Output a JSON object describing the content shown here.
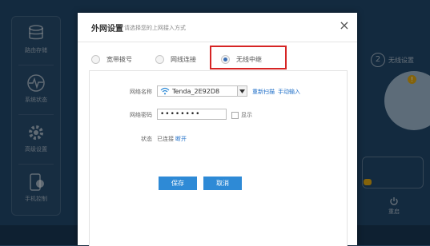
{
  "dialog": {
    "title": "外网设置",
    "subtitle": "请选择您的上网接入方式",
    "close_glyph": "×"
  },
  "modes": [
    {
      "label": "宽带拨号",
      "checked": false
    },
    {
      "label": "网线连接",
      "checked": false
    },
    {
      "label": "无线中继",
      "checked": true
    }
  ],
  "form": {
    "ssid_label": "网络名称",
    "ssid_value": "Tenda_2E92D8",
    "rescan": "重新扫描",
    "manual": "手动输入",
    "password_label": "网络密码",
    "password_value": "••••••••",
    "show_label": "显示",
    "status_label": "状态",
    "status_value": "已连接",
    "status_link": "断开"
  },
  "buttons": {
    "save": "保存",
    "cancel": "取消"
  },
  "background": {
    "sidebar": [
      {
        "label": "路由存储",
        "icon": "database-icon"
      },
      {
        "label": "系统状态",
        "icon": "pulse-icon"
      },
      {
        "label": "高级设置",
        "icon": "gear-icon"
      },
      {
        "label": "手机控制",
        "icon": "phone-icon"
      }
    ],
    "step_number": "2",
    "step_label": "无线设置",
    "badge": "!",
    "reboot_label": "重启"
  },
  "colors": {
    "accent": "#2e8ad6",
    "highlight_box": "#d62424",
    "link": "#1f6fc8",
    "radio_checked": "#3b6fb4"
  }
}
